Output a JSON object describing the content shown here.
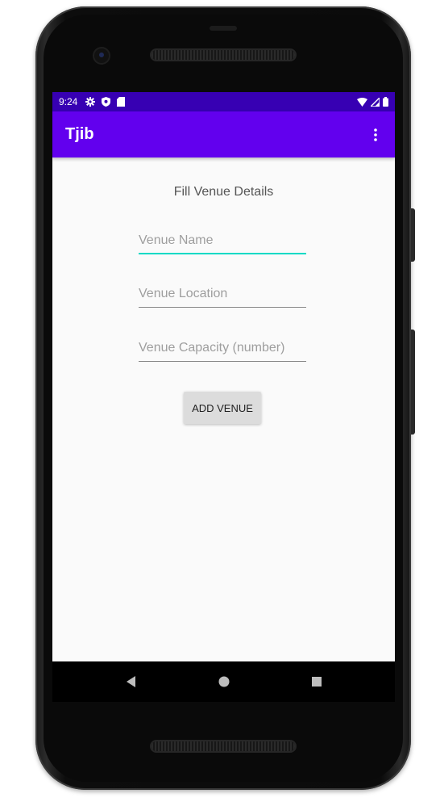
{
  "statusbar": {
    "time": "9:24",
    "icons": [
      "gear-icon",
      "shield-icon",
      "sd-card-icon"
    ],
    "right_icons": [
      "wifi-icon",
      "signal-icon",
      "battery-icon"
    ]
  },
  "appbar": {
    "title": "Tjib",
    "menu_icon": "overflow-menu-icon"
  },
  "form": {
    "heading": "Fill Venue Details",
    "venue_name": {
      "placeholder": "Venue Name",
      "value": ""
    },
    "venue_location": {
      "placeholder": "Venue Location",
      "value": ""
    },
    "venue_capacity": {
      "placeholder": "Venue Capacity (number)",
      "value": ""
    },
    "submit_label": "ADD VENUE"
  },
  "navbar": {
    "buttons": [
      "back-icon",
      "home-icon",
      "recents-icon"
    ]
  },
  "colors": {
    "statusbar": "#3700b3",
    "appbar": "#6200ee",
    "accent": "#03dac5",
    "background": "#fafafa"
  }
}
